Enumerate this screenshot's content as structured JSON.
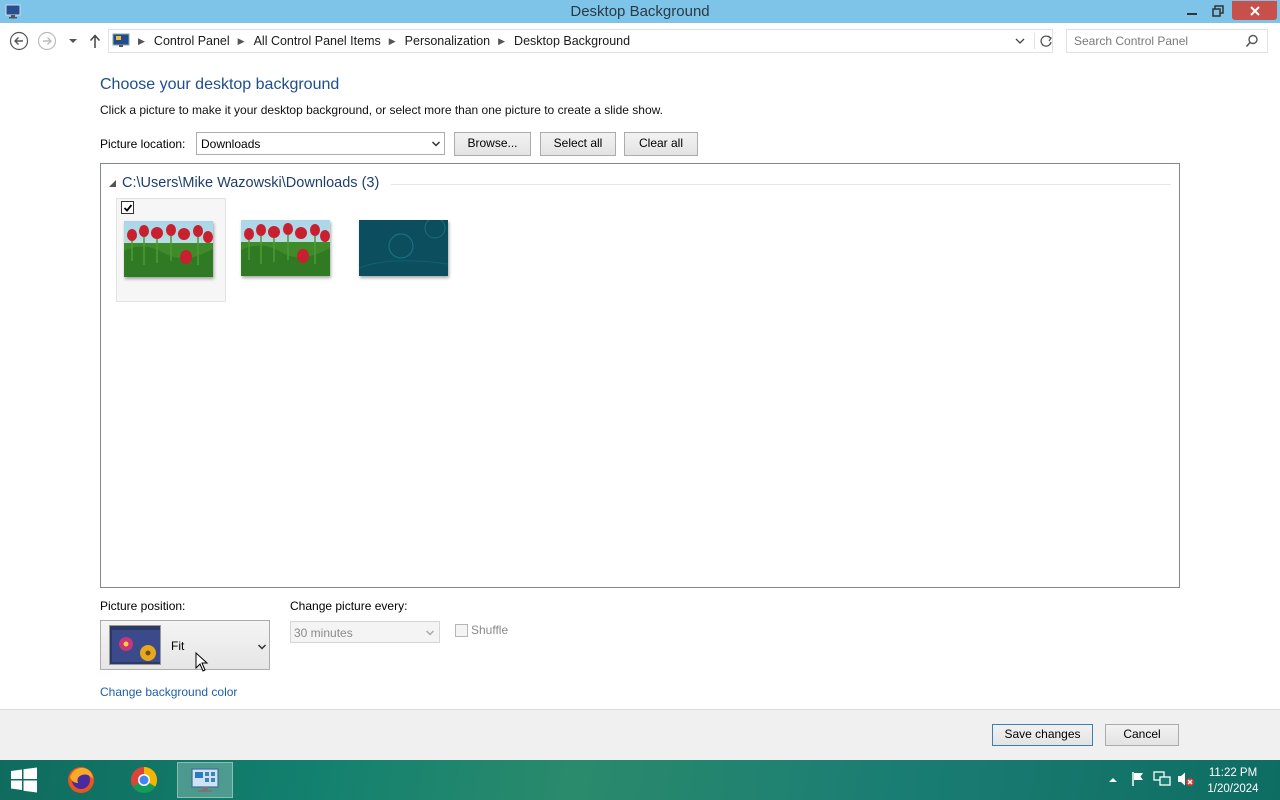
{
  "window": {
    "title": "Desktop Background",
    "controls": {
      "minimize": "minimize",
      "maximize": "maximize",
      "close": "close"
    }
  },
  "address_bar": {
    "breadcrumbs": [
      "Control Panel",
      "All Control Panel Items",
      "Personalization",
      "Desktop Background"
    ],
    "search_placeholder": "Search Control Panel"
  },
  "content": {
    "heading": "Choose your desktop background",
    "subtext": "Click a picture to make it your desktop background, or select more than one picture to create a slide show.",
    "picture_location_label": "Picture location:",
    "picture_location_value": "Downloads",
    "browse_label": "Browse...",
    "select_all_label": "Select all",
    "clear_all_label": "Clear all",
    "group_header": "C:\\Users\\Mike Wazowski\\Downloads (3)",
    "thumbnails": [
      {
        "name": "tulips",
        "checked": true
      },
      {
        "name": "tulips",
        "checked": false
      },
      {
        "name": "teal-abstract",
        "checked": false
      }
    ],
    "picture_position_label": "Picture position:",
    "picture_position_value": "Fit",
    "change_picture_label": "Change picture every:",
    "change_picture_value": "30 minutes",
    "shuffle_label": "Shuffle",
    "change_bg_color_link": "Change background color"
  },
  "footer": {
    "save_label": "Save changes",
    "cancel_label": "Cancel"
  },
  "taskbar": {
    "apps": [
      "windows-start",
      "firefox",
      "chrome",
      "control-panel"
    ],
    "clock_time": "11:22 PM",
    "clock_date": "1/20/2024"
  },
  "colors": {
    "titlebar": "#7ec4e8",
    "heading": "#1e4e8c",
    "link": "#1e5fa8",
    "close_button": "#c7504a",
    "taskbar": "#13816f"
  }
}
